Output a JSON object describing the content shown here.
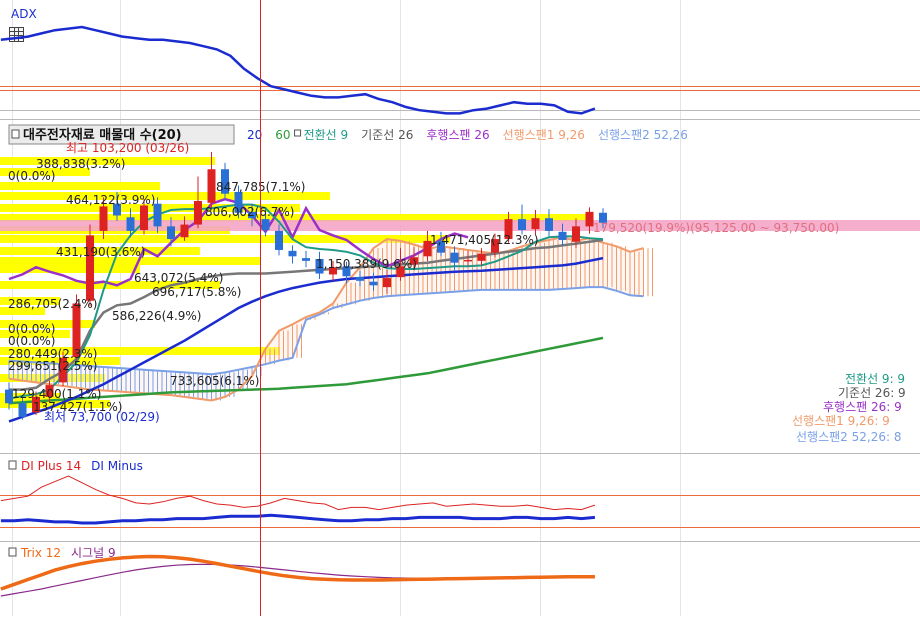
{
  "colors": {
    "bull": "#dd2222",
    "bear": "#2a6fd6",
    "ma20": "#1a2bd0",
    "ma60": "#2f9a3a",
    "conv": "#1f9a86",
    "base": "#777777",
    "lagging": "#9b30c9",
    "spanA": "#f19a6a",
    "spanB": "#7aa0e8",
    "adx": "#1a2bd0",
    "di_plus": "#dd2222",
    "di_minus": "#1a2bd0",
    "trix": "#ef6a16",
    "signal": "#8a2a8a",
    "ref_line": "#ee6a3a",
    "cursor": "#dd2222",
    "volume_band": "#ffff00",
    "price_band": "#f4a6c8"
  },
  "adx_panel": {
    "title": "ADX",
    "icon": "table-grid-icon"
  },
  "main_panel": {
    "title": "대주전자재료 매물대 수(20)",
    "legend": [
      {
        "label": "20",
        "color": "#1a2bd0"
      },
      {
        "label": "60",
        "color": "#2f9a3a"
      },
      {
        "label": "전환선 9",
        "color": "#1f9a86"
      },
      {
        "label": "기준선 26",
        "color": "#555555"
      },
      {
        "label": "후행스팬 26",
        "color": "#9b30c9"
      },
      {
        "label": "선행스팬1 9,26",
        "color": "#f19a6a"
      },
      {
        "label": "선행스팬2 52,26",
        "color": "#7aa0e8"
      }
    ],
    "high_label": "최고 103,200 (03/26)",
    "low_label": "최저 73,700 (02/29)",
    "range_label": "179,520(19.9%)(95,125.00 ~ 93,750.00)",
    "right_legend": [
      {
        "label": "전환선 9: 9",
        "color": "#1f9a86"
      },
      {
        "label": "기준선 26: 9",
        "color": "#555555"
      },
      {
        "label": "후행스팬 26: 9",
        "color": "#9b30c9"
      },
      {
        "label": "선행스팬1 9,26: 9",
        "color": "#f19a6a"
      },
      {
        "label": "선행스팬2 52,26: 8",
        "color": "#7aa0e8"
      }
    ],
    "volume_labels": [
      "388,838(3.2%)",
      "0(0.0%)",
      "464,122(3.9%)",
      "847,785(7.1%)",
      "806,002(6.7%)",
      "1,471,405(12.3%)",
      "431,190(3.6%)",
      "1,150,389(9.6%)",
      "643,072(5.4%)",
      "696,717(5.8%)",
      "286,705(2.4%)",
      "586,226(4.9%)",
      "0(0.0%)",
      "0(0.0%)",
      "280,449(2.3%)",
      "299,651(2.5%)",
      "733,605(6.1%)",
      "129,400(1.1%)",
      "137,427(1.1%)"
    ]
  },
  "di_panel": {
    "legend": [
      {
        "label": "DI Plus 14",
        "color": "#dd2222"
      },
      {
        "label": "DI Minus",
        "color": "#1a2bd0"
      }
    ]
  },
  "trix_panel": {
    "legend": [
      {
        "label": "Trix 12",
        "color": "#ef6a16"
      },
      {
        "label": "시그널 9",
        "color": "#8a2a8a"
      }
    ]
  },
  "chart_data": {
    "type": "line",
    "note_candles": "values in KRW",
    "candles": [
      [
        77000,
        75500,
        77800,
        74800
      ],
      [
        75500,
        74000,
        76200,
        73700
      ],
      [
        74500,
        76200,
        76800,
        74200
      ],
      [
        76200,
        77500,
        78000,
        75600
      ],
      [
        77800,
        80500,
        81200,
        77400
      ],
      [
        80600,
        86500,
        87500,
        80200
      ],
      [
        86800,
        94000,
        95200,
        86200
      ],
      [
        94500,
        97200,
        98200,
        93600
      ],
      [
        97500,
        96200,
        98800,
        95600
      ],
      [
        96000,
        94500,
        97000,
        93800
      ],
      [
        94600,
        97300,
        98000,
        94100
      ],
      [
        97500,
        95000,
        98200,
        94300
      ],
      [
        95000,
        93600,
        96000,
        92800
      ],
      [
        93800,
        95200,
        96100,
        93400
      ],
      [
        95200,
        97800,
        100500,
        94800
      ],
      [
        97600,
        101300,
        103200,
        97000
      ],
      [
        101300,
        98600,
        102000,
        97900
      ],
      [
        98800,
        96500,
        99500,
        95900
      ],
      [
        96600,
        95900,
        97500,
        95000
      ],
      [
        95800,
        94600,
        96900,
        93900
      ],
      [
        94500,
        92400,
        95200,
        91800
      ],
      [
        92300,
        91700,
        92900,
        90900
      ],
      [
        91500,
        91200,
        92300,
        90500
      ],
      [
        91400,
        89800,
        92200,
        89200
      ],
      [
        89700,
        90500,
        91200,
        89000
      ],
      [
        90600,
        89500,
        91100,
        88700
      ],
      [
        89400,
        89000,
        90100,
        88400
      ],
      [
        88900,
        88500,
        89900,
        87900
      ],
      [
        88300,
        89300,
        90200,
        87600
      ],
      [
        89400,
        90600,
        92600,
        89000
      ],
      [
        90800,
        91600,
        92700,
        90400
      ],
      [
        91700,
        93400,
        94500,
        91200
      ],
      [
        93400,
        92100,
        94400,
        91700
      ],
      [
        92100,
        91000,
        92800,
        90200
      ],
      [
        91200,
        91300,
        92300,
        90600
      ],
      [
        91200,
        92000,
        92600,
        90700
      ],
      [
        92100,
        93600,
        94200,
        91600
      ],
      [
        93600,
        95800,
        96600,
        93200
      ],
      [
        95800,
        94600,
        97400,
        94100
      ],
      [
        94700,
        95900,
        96800,
        94100
      ],
      [
        95900,
        94500,
        96900,
        93900
      ],
      [
        94400,
        93500,
        95300,
        92900
      ],
      [
        93300,
        95000,
        95900,
        92600
      ],
      [
        95000,
        96600,
        97100,
        94200
      ],
      [
        96500,
        95400,
        97000,
        94800
      ]
    ],
    "ma20": [
      73500,
      74000,
      74500,
      75000,
      75600,
      76200,
      76900,
      77600,
      78400,
      79200,
      80000,
      80800,
      81600,
      82400,
      83300,
      84200,
      85100,
      86000,
      86700,
      87300,
      87800,
      88200,
      88500,
      88800,
      89000,
      89200,
      89300,
      89400,
      89500,
      89600,
      89700,
      89800,
      89900,
      90000,
      90050,
      90100,
      90200,
      90300,
      90400,
      90500,
      90600,
      90700,
      90900,
      91200,
      91500
    ],
    "ma60": [
      75500,
      75600,
      75700,
      75800,
      75900,
      76000,
      76100,
      76200,
      76300,
      76400,
      76500,
      76600,
      76700,
      76750,
      76800,
      76850,
      76900,
      76950,
      77000,
      77050,
      77100,
      77200,
      77300,
      77400,
      77500,
      77600,
      77800,
      78000,
      78200,
      78400,
      78600,
      78800,
      79100,
      79400,
      79700,
      80000,
      80300,
      80600,
      80900,
      81200,
      81500,
      81800,
      82100,
      82400,
      82700
    ],
    "conversion": [
      76000,
      76300,
      76500,
      77000,
      78500,
      80000,
      83000,
      88000,
      92000,
      94000,
      95500,
      96300,
      96800,
      96900,
      96900,
      97000,
      97200,
      97400,
      97400,
      97000,
      95500,
      93600,
      92700,
      92500,
      92400,
      92200,
      91800,
      91000,
      90400,
      90300,
      90300,
      90400,
      90500,
      90600,
      90600,
      90700,
      91100,
      91700,
      92300,
      93300,
      93800,
      93900,
      93900,
      93700,
      93600
    ],
    "base": [
      77000,
      77000,
      77200,
      78200,
      79000,
      80400,
      83500,
      85500,
      86300,
      86500,
      87200,
      88000,
      88500,
      88800,
      89200,
      89500,
      89700,
      89800,
      89800,
      89800,
      89900,
      90000,
      90100,
      90200,
      90300,
      90400,
      90500,
      90600,
      90700,
      90800,
      90900,
      91000,
      91200,
      91400,
      91600,
      91800,
      92000,
      92200,
      92400,
      92600,
      92700,
      92900,
      93100,
      93300,
      93500
    ],
    "lagging": [
      89200,
      89700,
      90500,
      90000,
      89600,
      89000,
      88700,
      88900,
      88500,
      89200,
      92500,
      91700,
      93200,
      94600,
      95600,
      97500,
      98000,
      97600,
      96200,
      94400,
      96800,
      93800,
      97000,
      94600,
      94000,
      93500,
      92400,
      91400,
      90600,
      91200,
      91800,
      92600,
      93600,
      94200,
      93800
    ],
    "span1": [
      78200,
      78000,
      77800,
      77600,
      77400,
      77200,
      77000,
      76900,
      76800,
      76700,
      76600,
      76500,
      76400,
      76200,
      76000,
      75800,
      76200,
      77000,
      78500,
      81500,
      83500,
      84200,
      85000,
      85500,
      86500,
      88800,
      90500,
      92600,
      93600,
      93400,
      93000,
      92500,
      92800,
      92600,
      92400,
      92200,
      92000,
      92300,
      92800,
      93200,
      93500,
      93800,
      93400,
      93700,
      93200,
      92800,
      92200,
      92600
    ],
    "span2": [
      80200,
      80100,
      80000,
      79900,
      79800,
      79700,
      79600,
      79500,
      79400,
      79300,
      79200,
      79100,
      79000,
      78900,
      78800,
      78700,
      78900,
      79200,
      79500,
      79800,
      80200,
      80500,
      84700,
      85300,
      86000,
      86400,
      86800,
      87100,
      87300,
      87400,
      87500,
      87600,
      87700,
      87800,
      87900,
      88000,
      88000,
      88000,
      88000,
      88000,
      88000,
      88100,
      88200,
      88300,
      88300,
      87900,
      87400,
      87300
    ],
    "adx": [
      70,
      71,
      72,
      74,
      76,
      77,
      78,
      76,
      74,
      72,
      71,
      70,
      70,
      69,
      68,
      66,
      64,
      60,
      52,
      46,
      41,
      39,
      37,
      35,
      34,
      34,
      35,
      36,
      33,
      31,
      28,
      26,
      25,
      24,
      24,
      26,
      27,
      29,
      31,
      30,
      30,
      29,
      25,
      24,
      27
    ],
    "di_plus": [
      28,
      30,
      32,
      40,
      45,
      50,
      44,
      38,
      33,
      30,
      26,
      25,
      27,
      30,
      32,
      28,
      25,
      24,
      22,
      23,
      26,
      30,
      28,
      26,
      25,
      20,
      22,
      22,
      20,
      22,
      24,
      25,
      26,
      23,
      24,
      25,
      24,
      23,
      23,
      24,
      22,
      20,
      21,
      20,
      24
    ],
    "di_minus": [
      10,
      10,
      11,
      10,
      9,
      9,
      8,
      8,
      9,
      10,
      10,
      11,
      11,
      12,
      12,
      12,
      13,
      14,
      14,
      14,
      15,
      14,
      13,
      12,
      11,
      10,
      10,
      11,
      11,
      12,
      12,
      13,
      13,
      13,
      13,
      12,
      12,
      12,
      13,
      13,
      12,
      12,
      13,
      12,
      13
    ],
    "trix": [
      -0.5,
      -0.3,
      -0.1,
      0.1,
      0.3,
      0.45,
      0.58,
      0.68,
      0.76,
      0.82,
      0.86,
      0.88,
      0.87,
      0.83,
      0.77,
      0.68,
      0.58,
      0.47,
      0.36,
      0.25,
      0.15,
      0.06,
      -0.01,
      -0.06,
      -0.09,
      -0.11,
      -0.12,
      -0.12,
      -0.12,
      -0.11,
      -0.1,
      -0.09,
      -0.08,
      -0.07,
      -0.06,
      -0.05,
      -0.04,
      -0.03,
      -0.02,
      -0.01,
      0.0,
      0.01,
      0.02,
      0.02,
      0.02
    ],
    "signal": [
      -0.8,
      -0.7,
      -0.6,
      -0.5,
      -0.38,
      -0.26,
      -0.14,
      -0.02,
      0.1,
      0.21,
      0.31,
      0.39,
      0.46,
      0.51,
      0.54,
      0.55,
      0.54,
      0.52,
      0.48,
      0.43,
      0.37,
      0.31,
      0.25,
      0.19,
      0.14,
      0.09,
      0.05,
      0.02,
      -0.01,
      -0.03,
      -0.04,
      -0.05,
      -0.05,
      -0.05,
      -0.05,
      -0.04,
      -0.04,
      -0.03,
      -0.03,
      -0.02,
      -0.02,
      -0.01,
      0.0,
      0.0,
      0.01
    ]
  }
}
